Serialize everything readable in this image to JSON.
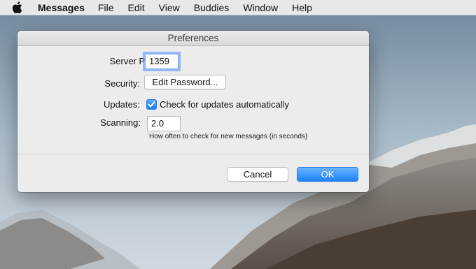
{
  "menubar": {
    "app_name": "Messages",
    "items": [
      "File",
      "Edit",
      "View",
      "Buddies",
      "Window",
      "Help"
    ]
  },
  "dialog": {
    "title": "Preferences",
    "server_port": {
      "label": "Server Port:",
      "value": "1359"
    },
    "security": {
      "label": "Security:",
      "button": "Edit Password..."
    },
    "updates": {
      "label": "Updates:",
      "checkbox_label": "Check for updates automatically",
      "checked": true
    },
    "scanning": {
      "label": "Scanning:",
      "value": "2.0",
      "hint": "How often to check for new messages (in seconds)"
    },
    "buttons": {
      "cancel": "Cancel",
      "ok": "OK"
    }
  },
  "colors": {
    "accent": "#1a82fb",
    "focus_ring": "#4d90fe"
  }
}
